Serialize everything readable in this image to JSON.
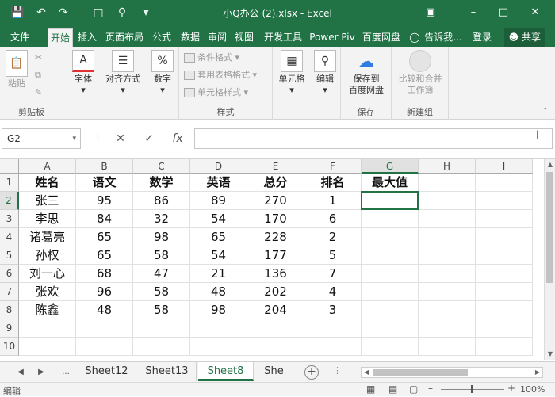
{
  "window": {
    "title": "小Q办公 (2).xlsx - Excel"
  },
  "tabs": {
    "file": "文件",
    "home": "开始",
    "insert": "插入",
    "layout": "页面布局",
    "formulas": "公式",
    "data": "数据",
    "review": "审阅",
    "view": "视图",
    "developer": "开发工具",
    "powerpivot": "Power Piv",
    "baidu": "百度网盘",
    "tellme": "告诉我...",
    "login": "登录",
    "share": "共享"
  },
  "ribbon": {
    "paste": "粘贴",
    "clipboard": "剪贴板",
    "font": "字体",
    "align": "对齐方式",
    "number": "数字",
    "cond_format": "条件格式",
    "table_format": "套用表格格式",
    "cell_style": "单元格样式",
    "styles": "样式",
    "cells": "单元格",
    "edit": "编辑",
    "save_baidu_line1": "保存到",
    "save_baidu_line2": "百度网盘",
    "save_group": "保存",
    "compare_line1": "比较和合并",
    "compare_line2": "工作簿",
    "new_group": "新建组"
  },
  "formula_bar": {
    "name_box": "G2",
    "fx": "fx",
    "content": ""
  },
  "columns": [
    "A",
    "B",
    "C",
    "D",
    "E",
    "F",
    "G",
    "H",
    "I"
  ],
  "rows": [
    "1",
    "2",
    "3",
    "4",
    "5",
    "6",
    "7",
    "8",
    "9",
    "10"
  ],
  "table": {
    "headers": [
      "姓名",
      "语文",
      "数学",
      "英语",
      "总分",
      "排名",
      "最大值"
    ],
    "data": [
      [
        "张三",
        "95",
        "86",
        "89",
        "270",
        "1"
      ],
      [
        "李思",
        "84",
        "32",
        "54",
        "170",
        "6"
      ],
      [
        "诸葛亮",
        "65",
        "98",
        "65",
        "228",
        "2"
      ],
      [
        "孙权",
        "65",
        "58",
        "54",
        "177",
        "5"
      ],
      [
        "刘一心",
        "68",
        "47",
        "21",
        "136",
        "7"
      ],
      [
        "张欢",
        "96",
        "58",
        "48",
        "202",
        "4"
      ],
      [
        "陈鑫",
        "48",
        "58",
        "98",
        "204",
        "3"
      ]
    ]
  },
  "sheets": {
    "ellipsis": "...",
    "list": [
      "Sheet12",
      "Sheet13",
      "Sheet8",
      "She"
    ],
    "active_index": 2
  },
  "status": {
    "mode": "编辑",
    "zoom": "100%"
  },
  "colors": {
    "accent": "#217346"
  }
}
